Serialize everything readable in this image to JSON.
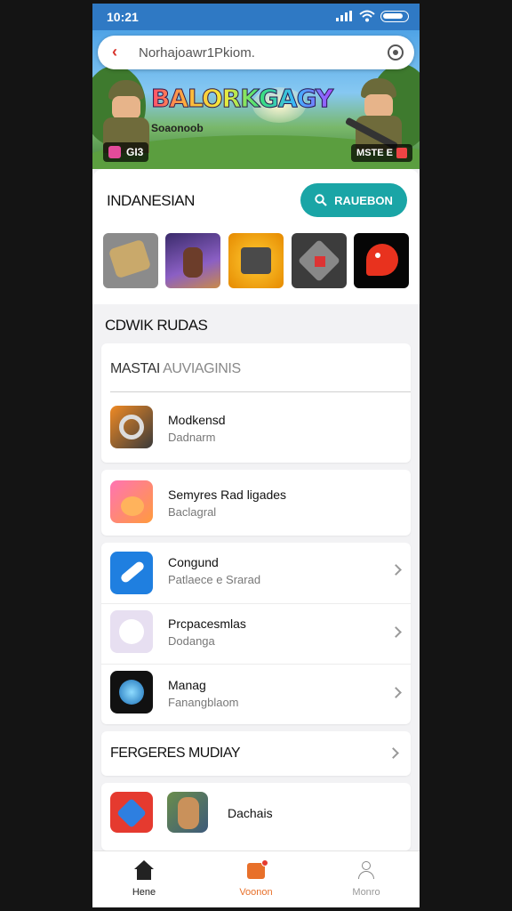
{
  "status_bar": {
    "time": "10:21"
  },
  "search": {
    "query": "Norhajoawr1Pkiom."
  },
  "banner": {
    "title": "BALORKGAGY",
    "subtitle": "Soaonoob",
    "badge_left": "GI3",
    "badge_right": "MSTE E"
  },
  "section1": {
    "title": "INDANESIAN",
    "button_label": "RAUEBON"
  },
  "section2": {
    "title": "CDWIK RUDAS",
    "subheader_dark": "MASTAI",
    "subheader_light": "AUVIAGINIS"
  },
  "items": [
    {
      "name": "Modkensd",
      "sub": "Dadnarm",
      "icon": "gauge-icon"
    },
    {
      "name": "Semyres Rad ligades",
      "sub": "Baclagral",
      "icon": "mushroom-character-icon"
    },
    {
      "name": "Congund",
      "sub": "Patlaece e Srarad",
      "icon": "paper-plane-icon"
    },
    {
      "name": "Prcpacesmlas",
      "sub": "Dodanga",
      "icon": "ghost-face-icon"
    },
    {
      "name": "Manag",
      "sub": "Fanangblaom",
      "icon": "globe-lens-icon"
    }
  ],
  "section3": {
    "title": "FERGERES MUDIAY"
  },
  "last_item": {
    "name": "Dachais"
  },
  "nav": [
    {
      "label": "Hene",
      "icon": "home-icon"
    },
    {
      "label": "Voonon",
      "icon": "game-icon"
    },
    {
      "label": "Monro",
      "icon": "profile-icon"
    }
  ],
  "colors": {
    "status_bar": "#2f79c4",
    "accent": "#1aa5a6",
    "active_tab": "#e8702a"
  }
}
